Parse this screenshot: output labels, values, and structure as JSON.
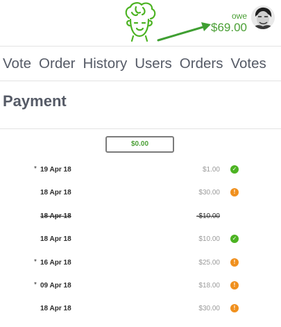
{
  "header": {
    "owe_label": "owe",
    "owe_amount": "$69.00",
    "mascot_icon": "salad-mascot-icon",
    "avatar_icon": "user-avatar-icon",
    "accent_color": "#4a9f35"
  },
  "nav": {
    "items": [
      "Vote",
      "Order",
      "History",
      "Users",
      "Orders",
      "Votes"
    ]
  },
  "page": {
    "title": "Payment"
  },
  "amount_field": {
    "value": "$0.00"
  },
  "payments": [
    {
      "star": "*",
      "date": "19 Apr 18",
      "amount": "$1.00",
      "status": "ok",
      "status_icon": "check-circle-icon",
      "struck": false
    },
    {
      "star": "",
      "date": "18 Apr 18",
      "amount": "$30.00",
      "status": "warn",
      "status_icon": "exclamation-circle-icon",
      "struck": false
    },
    {
      "star": "",
      "date": "18 Apr 18",
      "amount": "-$10.00",
      "status": "none",
      "status_icon": "",
      "struck": true
    },
    {
      "star": "",
      "date": "18 Apr 18",
      "amount": "$10.00",
      "status": "ok",
      "status_icon": "check-circle-icon",
      "struck": false
    },
    {
      "star": "*",
      "date": "16 Apr 18",
      "amount": "$25.00",
      "status": "warn",
      "status_icon": "exclamation-circle-icon",
      "struck": false
    },
    {
      "star": "*",
      "date": "09 Apr 18",
      "amount": "$18.00",
      "status": "warn",
      "status_icon": "exclamation-circle-icon",
      "struck": false
    },
    {
      "star": "",
      "date": "18 Apr 18",
      "amount": "$30.00",
      "status": "warn",
      "status_icon": "exclamation-circle-icon",
      "struck": false
    }
  ],
  "status_glyphs": {
    "ok": "✓",
    "warn": "!"
  }
}
